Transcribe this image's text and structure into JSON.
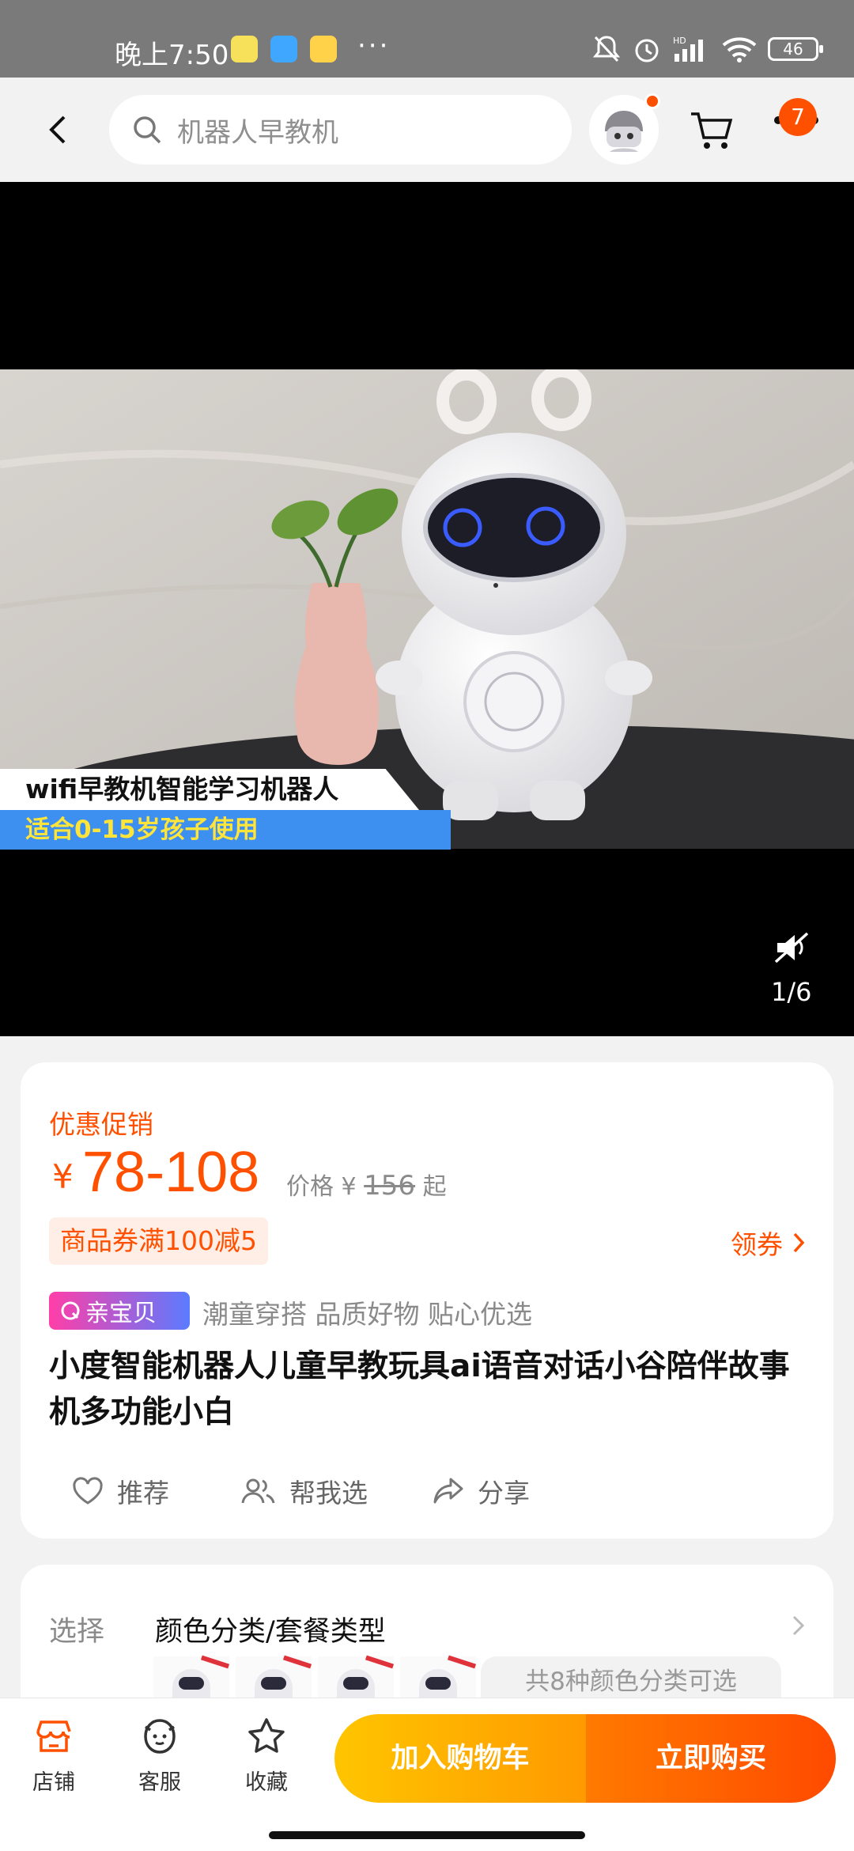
{
  "status_bar": {
    "time": "晚上7:50",
    "more": "···",
    "battery": "46",
    "network": "HD"
  },
  "nav": {
    "search_placeholder": "机器人早教机",
    "more_badge": "7"
  },
  "media": {
    "caption_line1": "wifi早教机智能学习机器人",
    "caption_line2": "适合0-15岁孩子使用",
    "page_indicator": "1/6"
  },
  "product": {
    "promo_label": "优惠促销",
    "currency": "¥",
    "price_range": "78-108",
    "orig_price_prefix": "价格 ¥",
    "orig_price": "156",
    "orig_price_suffix": "起",
    "coupon_tag": "商品券满100减5",
    "get_coupon": "领券",
    "brand_badge": "亲宝贝",
    "tagline": "潮童穿搭  品质好物  贴心优选",
    "title": "小度智能机器人儿童早教玩具ai语音对话小谷陪伴故事机多功能小白",
    "actions": {
      "recommend": "推荐",
      "help_choose": "帮我选",
      "share": "分享"
    }
  },
  "select": {
    "label": "选择",
    "value": "颜色分类/套餐类型",
    "variants_note": "共8种颜色分类可选"
  },
  "bottom_bar": {
    "shop": "店铺",
    "service": "客服",
    "favorite": "收藏",
    "add_to_cart": "加入购物车",
    "buy_now": "立即购买"
  },
  "colors": {
    "accent": "#ff5000",
    "cart_gradient": [
      "#ffc500",
      "#ff9a00"
    ],
    "buy_gradient": [
      "#ff7a00",
      "#ff4a00"
    ]
  }
}
